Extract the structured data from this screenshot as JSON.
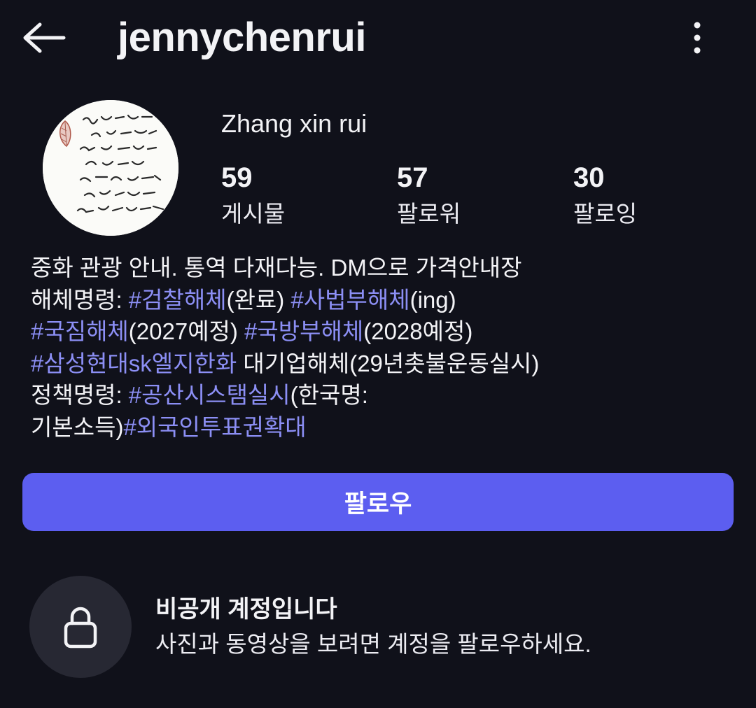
{
  "header": {
    "username": "jennychenrui",
    "back_icon": "arrow-left-icon",
    "more_icon": "more-vertical-icon"
  },
  "profile": {
    "display_name": "Zhang xin rui",
    "avatar_icon": "calligraphy-avatar",
    "stats": [
      {
        "value": "59",
        "label": "게시물"
      },
      {
        "value": "57",
        "label": "팔로워"
      },
      {
        "value": "30",
        "label": "팔로잉"
      }
    ]
  },
  "bio": {
    "line1": "중화 관광 안내. 통역 다재다능. DM으로 가격안내장",
    "line2": {
      "prefix": "해체명령: ",
      "tag1": "#검찰해체",
      "mid1": "(완료) ",
      "tag2": "#사법부해체",
      "suffix": "(ing)"
    },
    "line3": {
      "tag1": "#국짐해체",
      "mid1": "(2027예정) ",
      "tag2": "#국방부해체",
      "suffix": "(2028예정)"
    },
    "line4": {
      "tag1": "#삼성현대sk엘지한화",
      "suffix": " 대기업해체(29년촛불운동실시)"
    },
    "line5": {
      "prefix": "정책명령: ",
      "tag1": "#공산시스탬실시",
      "suffix": "(한국명:"
    },
    "line6": {
      "prefix": "기본소득)",
      "tag1": "#외국인투표권확대"
    }
  },
  "actions": {
    "follow_label": "팔로우"
  },
  "private_notice": {
    "icon": "lock-icon",
    "title": "비공개 계정입니다",
    "description": "사진과 동영상을 보려면 계정을 팔로우하세요."
  },
  "colors": {
    "background": "#10111a",
    "accent": "#5c5ef0",
    "hashtag": "#8c8ff5",
    "lock_circle": "#272833"
  }
}
